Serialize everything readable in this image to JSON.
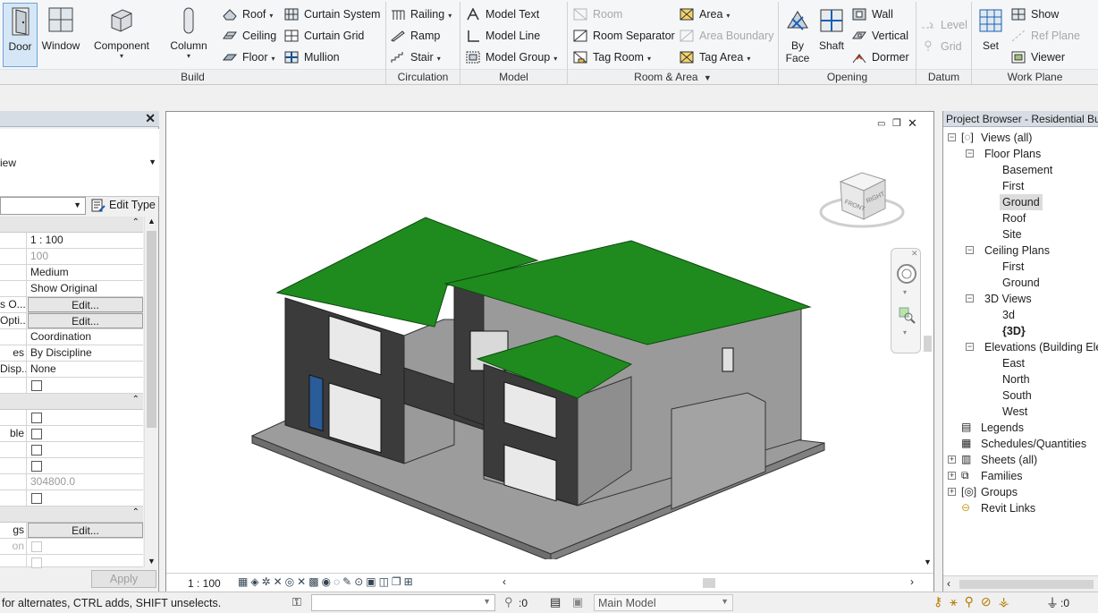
{
  "ribbon": {
    "build": {
      "door": "Door",
      "window": "Window",
      "component": "Component",
      "column": "Column",
      "roof": "Roof",
      "ceiling": "Ceiling",
      "floor": "Floor",
      "curtain_system": "Curtain System",
      "curtain_grid": "Curtain Grid",
      "mullion": "Mullion",
      "title": "Build"
    },
    "circulation": {
      "railing": "Railing",
      "ramp": "Ramp",
      "stair": "Stair",
      "title": "Circulation"
    },
    "model": {
      "model_text": "Model Text",
      "model_line": "Model Line",
      "model_group": "Model Group",
      "title": "Model"
    },
    "room_area": {
      "room": "Room",
      "room_separator": "Room Separator",
      "tag_room": "Tag Room",
      "area": "Area",
      "area_boundary": "Area Boundary",
      "tag_area": "Tag Area",
      "title": "Room & Area"
    },
    "opening": {
      "by_face_1": "By",
      "by_face_2": "Face",
      "shaft": "Shaft",
      "wall": "Wall",
      "vertical": "Vertical",
      "dormer": "Dormer",
      "title": "Opening"
    },
    "datum": {
      "level": "Level",
      "grid": "Grid",
      "title": "Datum"
    },
    "work_plane": {
      "set": "Set",
      "show": "Show",
      "ref_plane": "Ref  Plane",
      "viewer": "Viewer",
      "title": "Work Plane"
    }
  },
  "properties": {
    "type_label": "iew",
    "edit_type": "Edit Type",
    "rows": {
      "view_scale": "1 : 100",
      "scale_value": "100",
      "detail_level": "Medium",
      "parts_visibility": "Show Original",
      "vg_label": "s O...",
      "edit": "Edit...",
      "graphic_label": "Opti...",
      "discipline": "Coordination",
      "show_hidden_label": "es",
      "show_hidden": "By Discipline",
      "default_disp_label": "Disp...",
      "default_disp": "None",
      "ble_label": "ble",
      "eye_elev": "304800.0",
      "gs_label": "gs",
      "on_label": "on"
    },
    "apply": "Apply"
  },
  "viewport": {
    "scale": "1 : 100",
    "viewcube_front": "FRONT",
    "viewcube_right": "RIGHT"
  },
  "browser": {
    "title": "Project Browser - Residential Buil",
    "views_all": "Views (all)",
    "floor_plans": "Floor Plans",
    "fp": [
      "Basement",
      "First",
      "Ground",
      "Roof",
      "Site"
    ],
    "ceiling_plans": "Ceiling Plans",
    "cp": [
      "First",
      "Ground"
    ],
    "views_3d": "3D Views",
    "v3": [
      "3d",
      "{3D}"
    ],
    "elevations": "Elevations (Building Elev",
    "el": [
      "East",
      "North",
      "South",
      "West"
    ],
    "legends": "Legends",
    "schedules": "Schedules/Quantities",
    "sheets": "Sheets (all)",
    "families": "Families",
    "groups": "Groups",
    "revit_links": "Revit Links"
  },
  "status": {
    "hint": "for alternates, CTRL adds, SHIFT unselects.",
    "worksets": ":0",
    "model": "Main Model",
    "filter": ":0"
  },
  "colors": {
    "roof": "#1f8b1f",
    "wall_dark": "#3a3a3a",
    "wall_light": "#9a9a9a",
    "accent": "#3399ff"
  }
}
